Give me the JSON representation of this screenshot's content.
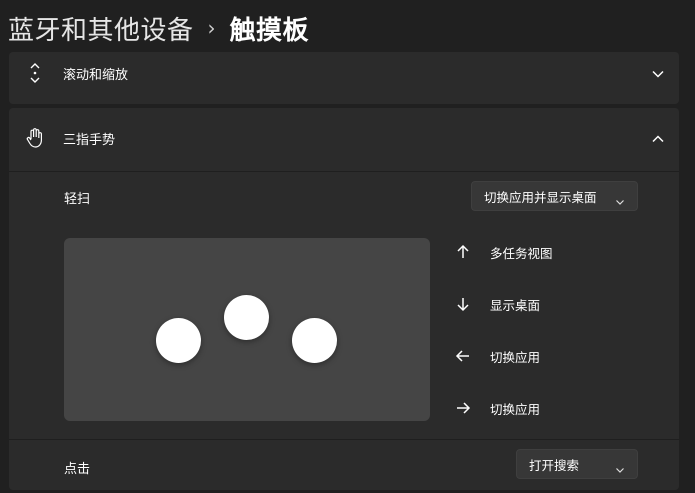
{
  "breadcrumb": {
    "parent": "蓝牙和其他设备",
    "separator": "›",
    "current": "触摸板"
  },
  "scroll_section": {
    "label": "滚动和缩放",
    "icon": "scroll-arrows-icon",
    "expanded": false
  },
  "three_finger": {
    "label": "三指手势",
    "icon": "hand-icon",
    "expanded": true,
    "swipe": {
      "label": "轻扫",
      "selected": "切换应用并显示桌面"
    },
    "gestures": [
      {
        "icon": "arrow-up-icon",
        "label": "多任务视图"
      },
      {
        "icon": "arrow-down-icon",
        "label": "显示桌面"
      },
      {
        "icon": "arrow-left-icon",
        "label": "切换应用"
      },
      {
        "icon": "arrow-right-icon",
        "label": "切换应用"
      }
    ],
    "tap": {
      "label": "点击",
      "selected": "打开搜索"
    }
  },
  "colors": {
    "background": "#202020",
    "card": "#2b2b2b",
    "pad": "#454545",
    "dropdown": "#373737"
  }
}
